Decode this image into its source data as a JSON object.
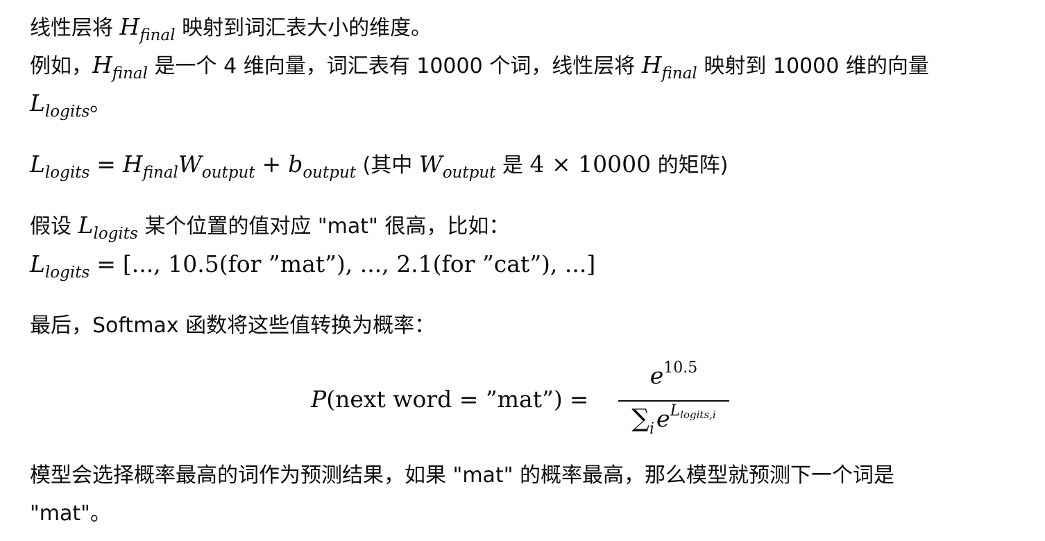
{
  "p1": {
    "pre": "线性层将 ",
    "h": "H",
    "h_sub": "final",
    "post": " 映射到词汇表大小的维度。"
  },
  "p2": {
    "t1": "例如，",
    "h": "H",
    "h_sub": "final",
    "t2": " 是一个 4 维向量，词汇表有 10000 个词，线性层将 ",
    "h2": "H",
    "h2_sub": "final",
    "t3": " 映射到 10000 维的向量",
    "l": "L",
    "l_sub": "logits",
    "t4": "。"
  },
  "eq1": {
    "l": "L",
    "l_sub": "logits",
    "eq": "=",
    "h": "H",
    "h_sub": "final",
    "w": "W",
    "w_sub": "output",
    "plus": "+",
    "b": "b",
    "b_sub": "output",
    "note_pre": " (其中 ",
    "w2": "W",
    "w2_sub": "output",
    "note_mid": " 是 ",
    "dims": "4 × 10000",
    "note_post": " 的矩阵)"
  },
  "p3": {
    "pre": "假设 ",
    "l": "L",
    "l_sub": "logits",
    "post": " 某个位置的值对应 \"mat\" 很高，比如："
  },
  "eq2": {
    "l": "L",
    "l_sub": "logits",
    "eq": "=",
    "rhs": "[..., 10.5(for ”mat”), ..., 2.1(for ”cat”), ...]"
  },
  "p4": {
    "text": "最后，Softmax 函数将这些值转换为概率："
  },
  "softmax": {
    "p": "P",
    "lhs_arg": "(next word = ”mat”)",
    "eq": "=",
    "num_base": "e",
    "num_exp": "10.5",
    "den_sum": "∑",
    "den_sum_sub": "i",
    "den_base": "e",
    "den_exp": "L",
    "den_exp_sub": "logits,i"
  },
  "p5": {
    "line1": "模型会选择概率最高的词作为预测结果，如果 \"mat\" 的概率最高，那么模型就预测下一个词是",
    "line2": "\"mat\"。"
  }
}
